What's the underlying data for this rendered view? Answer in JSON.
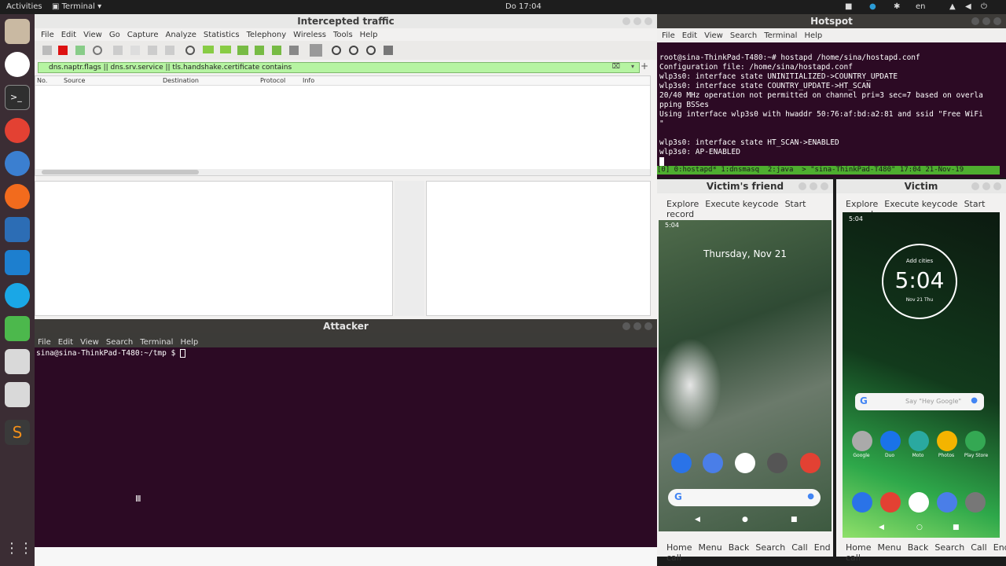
{
  "topbar": {
    "activities": "Activities",
    "app_name": "Terminal",
    "clock": "Do 17:04",
    "lang": "en"
  },
  "colors": {
    "dock": "#3b2d34",
    "terminal_bg": "#2c0a24",
    "filter_ok": "#b6f4a2"
  },
  "wireshark": {
    "title": "Intercepted traffic",
    "menu": [
      "File",
      "Edit",
      "View",
      "Go",
      "Capture",
      "Analyze",
      "Statistics",
      "Telephony",
      "Wireless",
      "Tools",
      "Help"
    ],
    "filter": "dns.naptr.flags || dns.srv.service || tls.handshake.certificate contains",
    "columns": [
      "No.",
      "Source",
      "Destination",
      "Protocol",
      "Info"
    ]
  },
  "hotspot": {
    "title": "Hotspot",
    "menu": [
      "File",
      "Edit",
      "View",
      "Search",
      "Terminal",
      "Help"
    ],
    "lines": [
      "root@sina-ThinkPad-T480:~# hostapd /home/sina/hostapd.conf",
      "Configuration file: /home/sina/hostapd.conf",
      "wlp3s0: interface state UNINITIALIZED->COUNTRY_UPDATE",
      "wlp3s0: interface state COUNTRY_UPDATE->HT_SCAN",
      "20/40 MHz operation not permitted on channel pri=3 sec=7 based on overla",
      "pping BSSes",
      "Using interface wlp3s0 with hwaddr 50:76:af:bd:a2:81 and ssid \"Free WiFi",
      "\"",
      "wlp3s0: interface state HT_SCAN->ENABLED",
      "wlp3s0: AP-ENABLED"
    ],
    "status": "[0] 0:hostapd* 1:dnsmasq  2:java  > \"sina-ThinkPad-T480\" 17:04 21-Nov-19"
  },
  "attacker": {
    "title": "Attacker",
    "menu": [
      "File",
      "Edit",
      "View",
      "Search",
      "Terminal",
      "Help"
    ],
    "prompt": "sina@sina-ThinkPad-T480:~/tmp $ "
  },
  "friend": {
    "title": "Victim's friend",
    "toolbar": [
      "Explore",
      "Execute keycode",
      "Start record"
    ],
    "time": "5:04",
    "date": "Thursday, Nov 21",
    "bottom": [
      "Home",
      "Menu",
      "Back",
      "Search",
      "Call",
      "End call"
    ]
  },
  "victim": {
    "title": "Victim",
    "toolbar": [
      "Explore",
      "Execute keycode",
      "Start record"
    ],
    "time": "5:04",
    "clock_big": "5:04",
    "clock_top": "Add cities",
    "clock_date": "Nov 21 Thu",
    "search": "Say \"Hey Google\"",
    "apps": [
      "Google",
      "Duo",
      "Moto",
      "Photos",
      "Play Store"
    ],
    "bottom": [
      "Home",
      "Menu",
      "Back",
      "Search",
      "Call",
      "End call"
    ]
  }
}
